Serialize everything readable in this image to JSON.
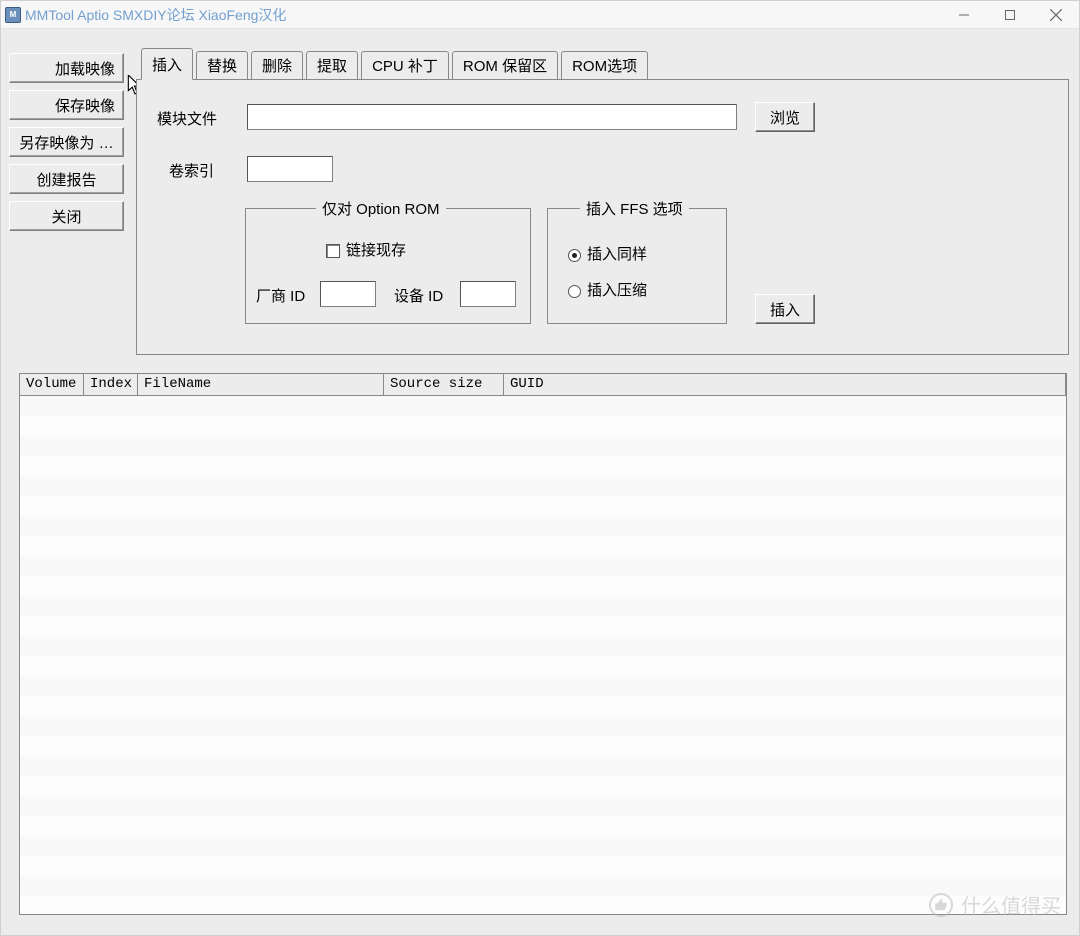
{
  "title": "MMTool Aptio SMXDIY论坛 XiaoFeng汉化",
  "sidebar": {
    "load_image": "加载映像",
    "save_image": "保存映像",
    "save_image_as": "另存映像为 …",
    "create_report": "创建报告",
    "close": "关闭"
  },
  "tabs": [
    "插入",
    "替换",
    "删除",
    "提取",
    "CPU 补丁",
    "ROM 保留区",
    "ROM选项"
  ],
  "active_tab": 0,
  "insert_panel": {
    "module_file": {
      "label": "模块文件",
      "value": ""
    },
    "browse": "浏览",
    "vol_index": {
      "label": "卷索引",
      "value": ""
    },
    "opt_rom_group": {
      "legend": "仅对 Option ROM",
      "link_existing": {
        "label": "链接现存",
        "checked": false
      },
      "vendor_id": {
        "label": "厂商 ID",
        "value": ""
      },
      "device_id": {
        "label": "设备 ID",
        "value": ""
      }
    },
    "ffs_group": {
      "legend": "插入 FFS 选项",
      "insert_same": "插入同样",
      "insert_compressed": "插入压缩",
      "selected": "insert_same"
    },
    "insert_button": "插入"
  },
  "columns": {
    "volume": "Volume",
    "index": "Index",
    "filename": "FileName",
    "source_size": "Source size",
    "guid": "GUID"
  },
  "watermark": "什么值得买"
}
